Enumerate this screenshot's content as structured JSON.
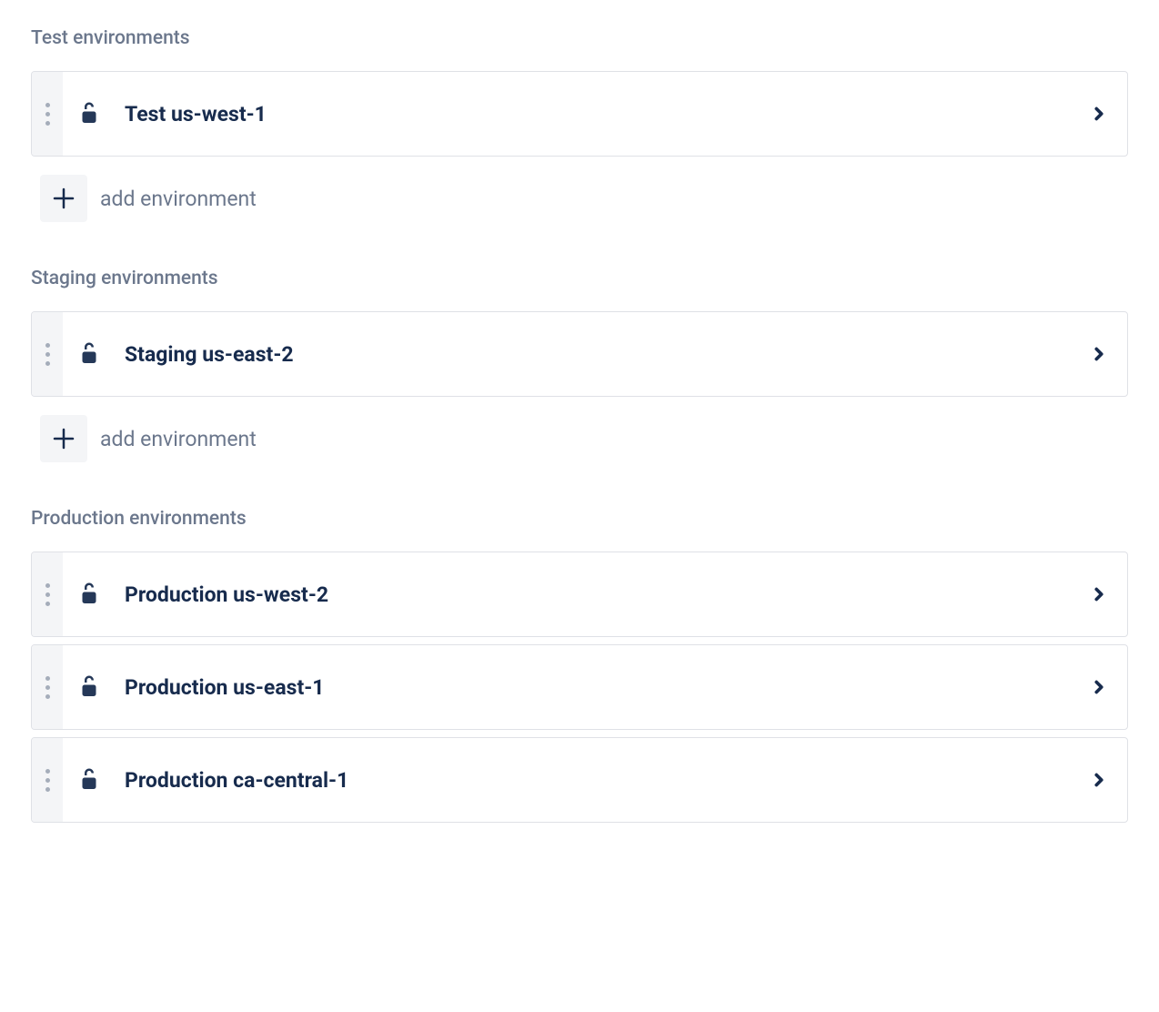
{
  "sections": [
    {
      "title": "Test environments",
      "environments": [
        {
          "name": "Test us-west-1"
        }
      ],
      "addLabel": "add environment",
      "showAdd": true
    },
    {
      "title": "Staging environments",
      "environments": [
        {
          "name": "Staging us-east-2"
        }
      ],
      "addLabel": "add environment",
      "showAdd": true
    },
    {
      "title": "Production environments",
      "environments": [
        {
          "name": "Production us-west-2"
        },
        {
          "name": "Production us-east-1"
        },
        {
          "name": "Production ca-central-1"
        }
      ],
      "showAdd": false
    }
  ]
}
